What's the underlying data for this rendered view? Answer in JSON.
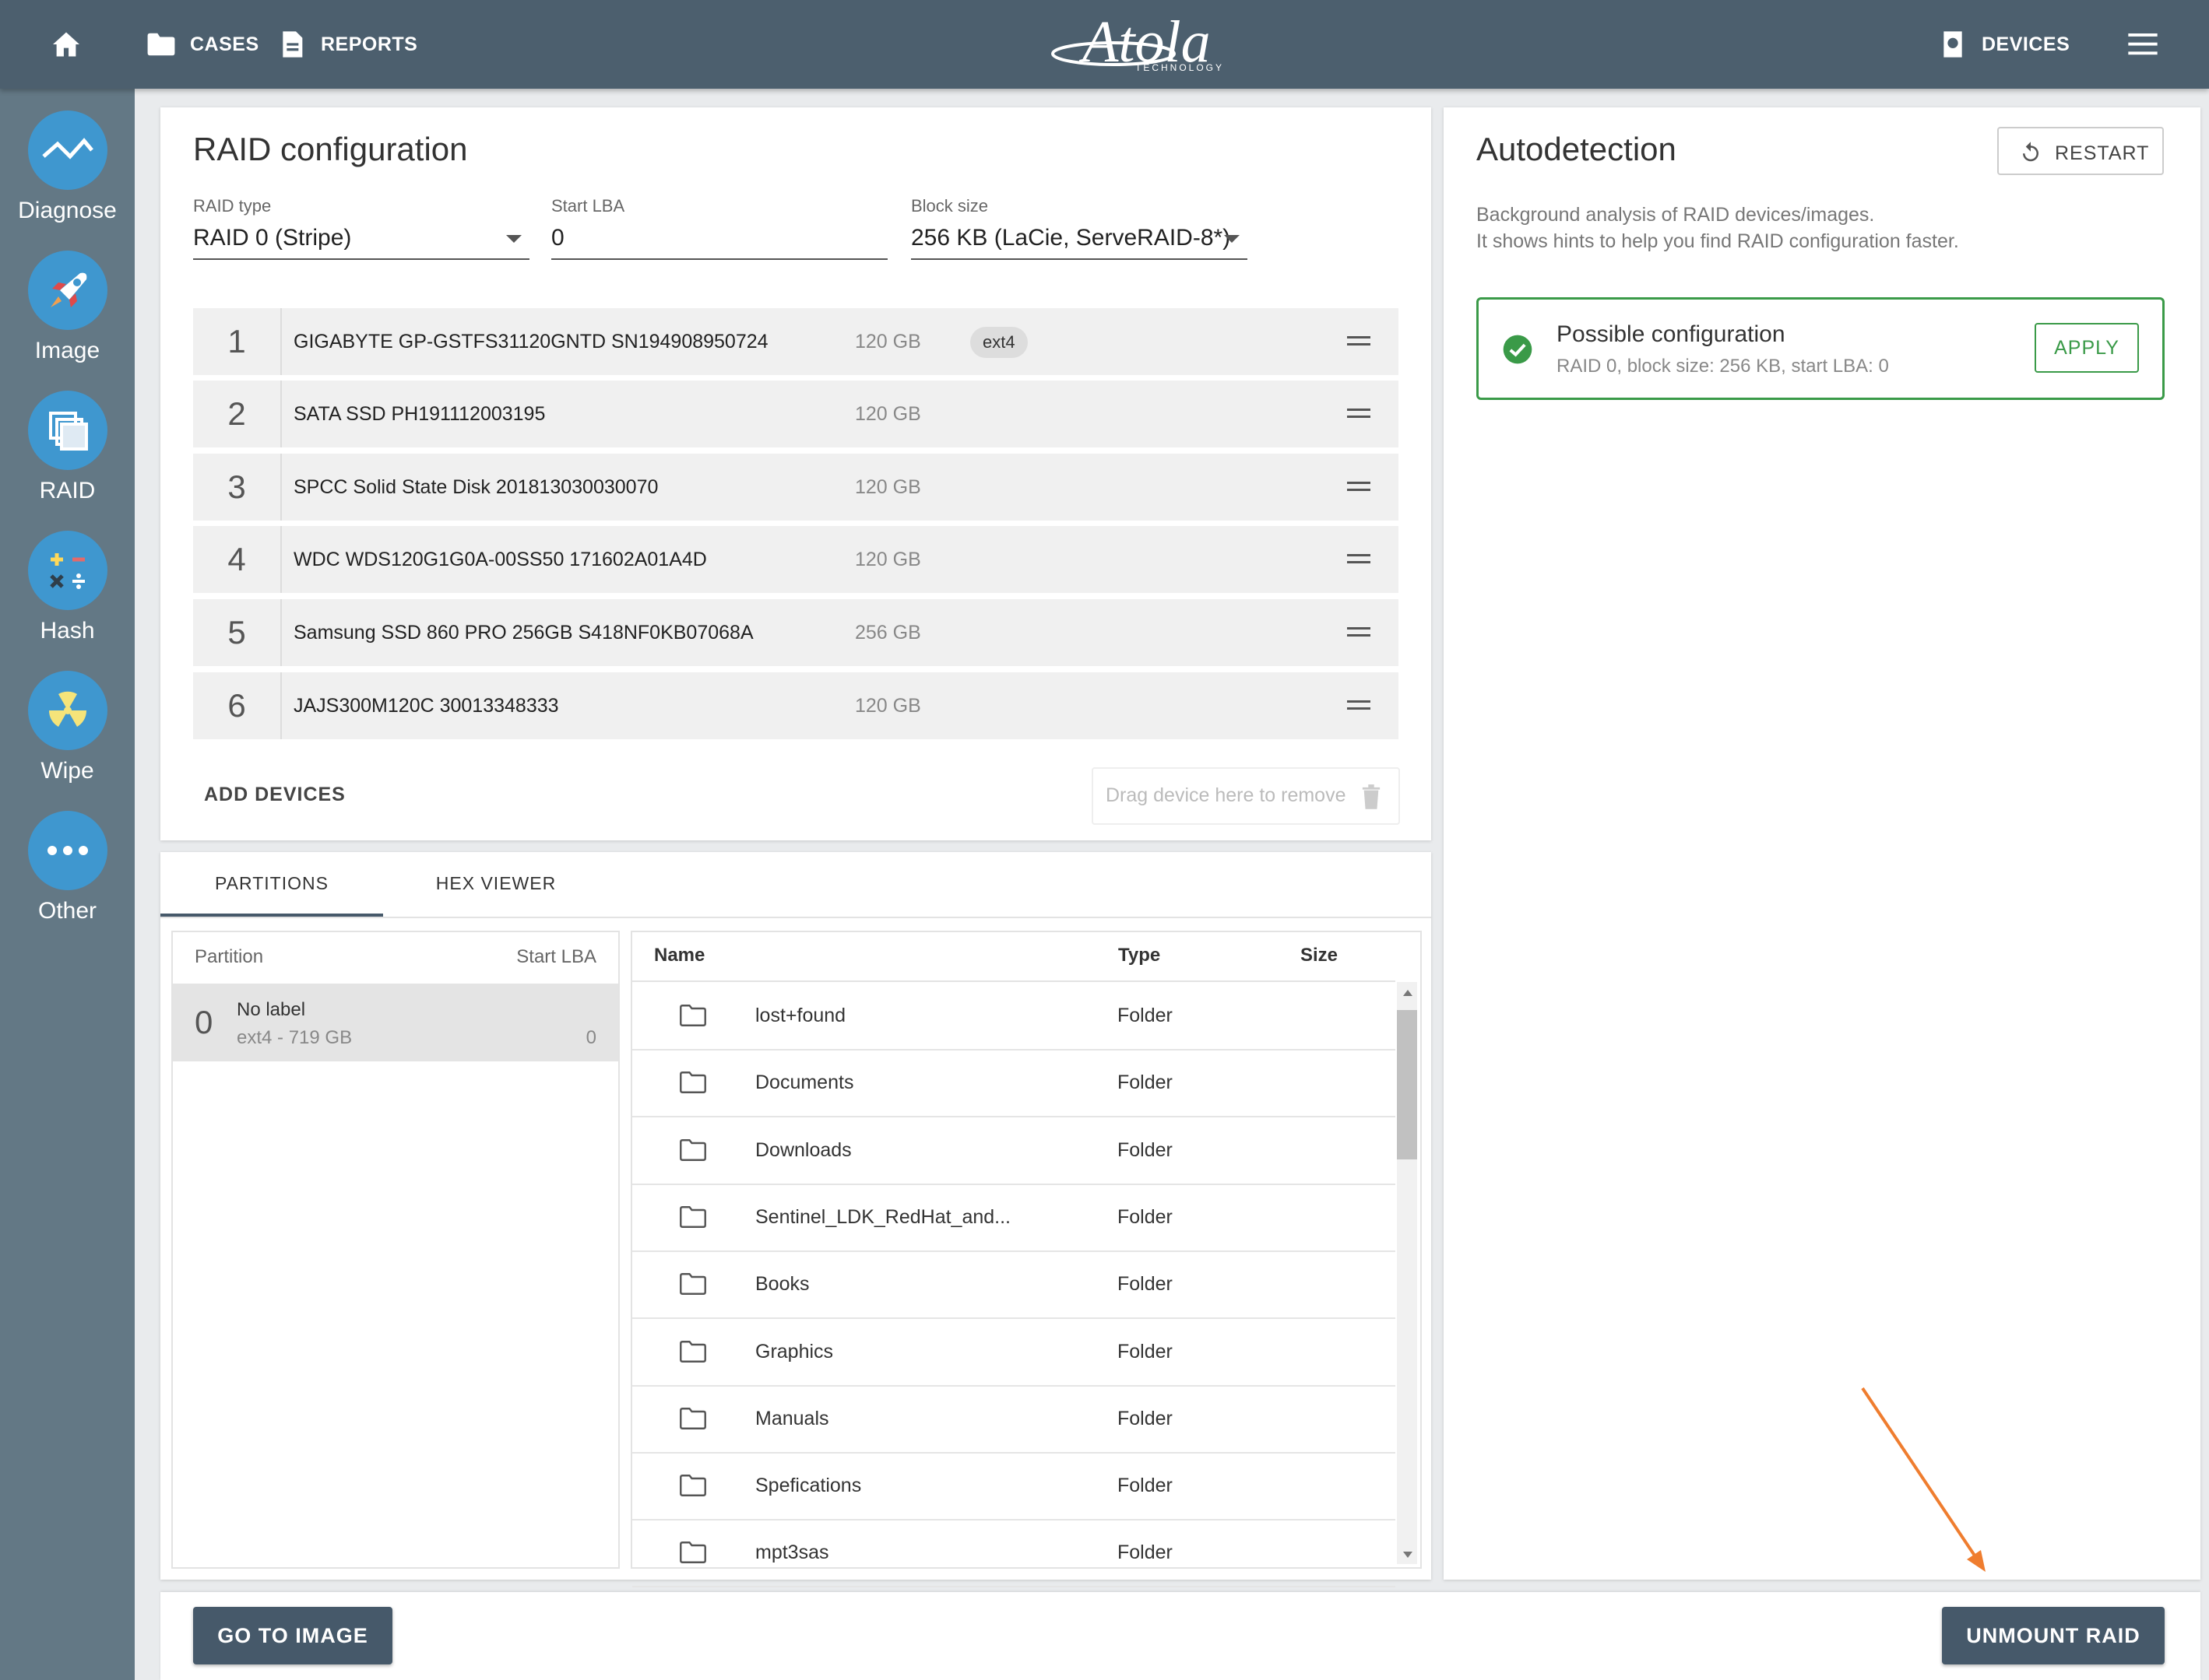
{
  "topbar": {
    "cases": "CASES",
    "reports": "REPORTS",
    "logo_word": "Atola",
    "logo_sub": "TECHNOLOGY",
    "devices": "DEVICES"
  },
  "sidebar": {
    "items": [
      {
        "label": "Diagnose",
        "icon": "diagnose-icon"
      },
      {
        "label": "Image",
        "icon": "rocket-icon"
      },
      {
        "label": "RAID",
        "icon": "raid-icon"
      },
      {
        "label": "Hash",
        "icon": "hash-icon"
      },
      {
        "label": "Wipe",
        "icon": "radiation-icon"
      },
      {
        "label": "Other",
        "icon": "more-icon"
      }
    ]
  },
  "raid": {
    "title": "RAID configuration",
    "raid_type_label": "RAID type",
    "raid_type_value": "RAID 0 (Stripe)",
    "start_lba_label": "Start LBA",
    "start_lba_value": "0",
    "block_size_label": "Block size",
    "block_size_value": "256 KB (LaCie, ServeRAID-8*)",
    "devices": [
      {
        "num": "1",
        "name": "GIGABYTE GP-GSTFS31120GNTD SN194908950724",
        "size": "120 GB",
        "fs": "ext4"
      },
      {
        "num": "2",
        "name": "SATA SSD PH191112003195",
        "size": "120 GB",
        "fs": ""
      },
      {
        "num": "3",
        "name": "SPCC Solid State Disk 201813030030070",
        "size": "120 GB",
        "fs": ""
      },
      {
        "num": "4",
        "name": "WDC WDS120G1G0A-00SS50 171602A01A4D",
        "size": "120 GB",
        "fs": ""
      },
      {
        "num": "5",
        "name": "Samsung SSD 860 PRO 256GB S418NF0KB07068A",
        "size": "256 GB",
        "fs": ""
      },
      {
        "num": "6",
        "name": "JAJS300M120C 30013348333",
        "size": "120 GB",
        "fs": ""
      }
    ],
    "add_devices": "ADD DEVICES",
    "drag_remove": "Drag device here to remove"
  },
  "tabs": {
    "partitions": "PARTITIONS",
    "hex_viewer": "HEX VIEWER"
  },
  "partitions": {
    "col_partition": "Partition",
    "col_start": "Start LBA",
    "rows": [
      {
        "index": "0",
        "label": "No label",
        "detail": "ext4 - 719 GB",
        "start": "0"
      }
    ]
  },
  "files": {
    "col_name": "Name",
    "col_type": "Type",
    "col_size": "Size",
    "rows": [
      {
        "name": "lost+found",
        "type": "Folder"
      },
      {
        "name": "Documents",
        "type": "Folder"
      },
      {
        "name": "Downloads",
        "type": "Folder"
      },
      {
        "name": "Sentinel_LDK_RedHat_and...",
        "type": "Folder"
      },
      {
        "name": "Books",
        "type": "Folder"
      },
      {
        "name": "Graphics",
        "type": "Folder"
      },
      {
        "name": "Manuals",
        "type": "Folder"
      },
      {
        "name": "Spefications",
        "type": "Folder"
      },
      {
        "name": "mpt3sas",
        "type": "Folder"
      }
    ]
  },
  "autodetect": {
    "title": "Autodetection",
    "restart": "RESTART",
    "desc1": "Background analysis of RAID devices/images.",
    "desc2": "It shows hints to help you find RAID configuration faster.",
    "possible_title": "Possible configuration",
    "possible_detail": "RAID 0, block size: 256 KB, start LBA: 0",
    "apply": "APPLY"
  },
  "footer": {
    "go_to_image": "GO TO IMAGE",
    "unmount_raid": "UNMOUNT RAID"
  },
  "colors": {
    "topbar": "#4c5f6e",
    "sidebar": "#637885",
    "accent_blue": "#3f97cf",
    "success_green": "#3a9a48",
    "annotation_arrow": "#ef7d2f"
  }
}
